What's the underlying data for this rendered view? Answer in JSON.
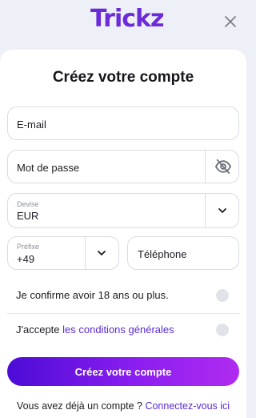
{
  "header": {
    "logo_text": "Trickz",
    "close_icon": "close-icon",
    "brand_color": "#6b2bd9"
  },
  "form": {
    "title": "Créez votre compte",
    "email": {
      "placeholder": "E-mail"
    },
    "password": {
      "placeholder": "Mot de passe",
      "toggle_icon": "eye-off-icon"
    },
    "currency": {
      "label": "Devise",
      "value": "EUR",
      "icon": "chevron-down-icon"
    },
    "phone_prefix": {
      "label": "Préfixe",
      "value": "+49",
      "icon": "chevron-down-icon"
    },
    "phone": {
      "placeholder": "Téléphone"
    },
    "age_confirm": {
      "label": "Je confirme avoir 18 ans ou plus.",
      "checked": false
    },
    "terms": {
      "prefix": "J'accepte ",
      "link": "les conditions générales",
      "checked": false
    },
    "submit_label": "Créez votre compte",
    "footer": {
      "text": "Vous avez déjà un compte ? ",
      "link": "Connectez-vous ici"
    }
  },
  "colors": {
    "accent": "#5a2bd4",
    "gradient_start": "#4c0bd6",
    "gradient_end": "#b02bf0"
  }
}
